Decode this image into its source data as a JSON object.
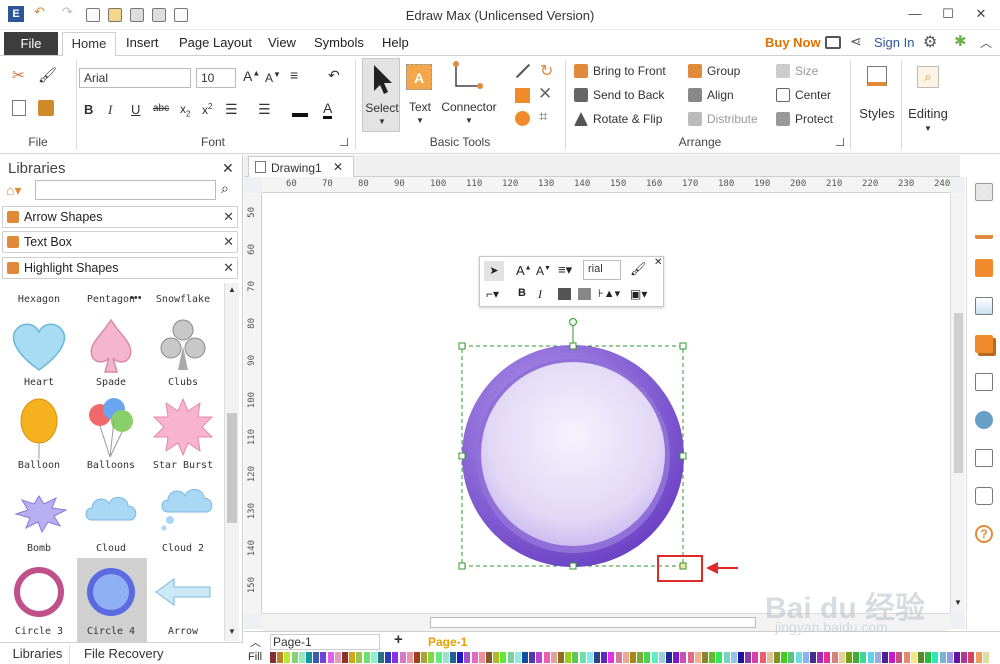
{
  "window": {
    "title": "Edraw Max (Unlicensed Version)",
    "controls": [
      "—",
      "☐",
      "✕"
    ]
  },
  "menu": {
    "file": "File",
    "tabs": [
      "Home",
      "Insert",
      "Page Layout",
      "View",
      "Symbols",
      "Help"
    ],
    "buy_now": "Buy Now",
    "sign_in": "Sign In"
  },
  "ribbon": {
    "groups": {
      "file": "File",
      "font": "Font",
      "basic_tools": "Basic Tools",
      "arrange": "Arrange"
    },
    "font_name": "Arial",
    "font_size": "10",
    "select": "Select",
    "text": "Text",
    "connector": "Connector",
    "bring_to_front": "Bring to Front",
    "send_to_back": "Send to Back",
    "rotate_flip": "Rotate & Flip",
    "group": "Group",
    "align": "Align",
    "distribute": "Distribute",
    "size": "Size",
    "center": "Center",
    "protect": "Protect",
    "styles": "Styles",
    "editing": "Editing"
  },
  "libraries": {
    "title": "Libraries",
    "categories": [
      "Arrow Shapes",
      "Text Box",
      "Highlight Shapes"
    ],
    "shape_row0": [
      "Hexagon",
      "Pentagon",
      "Snowflake"
    ],
    "shapes": [
      "Heart",
      "Spade",
      "Clubs",
      "Balloon",
      "Balloons",
      "Star Burst",
      "Bomb",
      "Cloud",
      "Cloud 2",
      "Circle 3",
      "Circle 4",
      "Arrow"
    ],
    "bottom_tabs": [
      "Libraries",
      "File Recovery"
    ]
  },
  "document": {
    "tab": "Drawing1",
    "ruler_top": [
      "60",
      "70",
      "80",
      "90",
      "100",
      "110",
      "120",
      "130",
      "140",
      "150",
      "160",
      "170",
      "180",
      "190",
      "200",
      "210",
      "220",
      "230",
      "240"
    ],
    "ruler_left": [
      "50",
      "60",
      "70",
      "80",
      "90",
      "100",
      "110",
      "120",
      "130",
      "140",
      "150"
    ]
  },
  "minibar": {
    "font": "rial"
  },
  "pages": {
    "page_select": "Page-1",
    "active_page": "Page-1",
    "fill_label": "Fill"
  },
  "colors": {
    "accent": "#2b579a",
    "buy_now": "#e07000",
    "circle_outer": "#7b4fd1",
    "circle_inner": "#e4dcf6",
    "selection": "#2e9b2e",
    "highlight_box": "#e02a2a",
    "page_tab": "#e8a000"
  },
  "watermark": {
    "text": "Bai du 经验",
    "url": "jingyan.baidu.com"
  }
}
